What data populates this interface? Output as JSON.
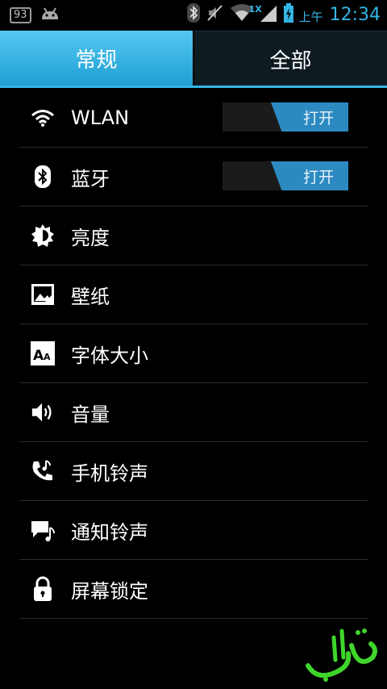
{
  "status_bar": {
    "notification_badge": "93",
    "ampm": "上午",
    "time": "12:34",
    "network_type": "1X"
  },
  "tabs": [
    {
      "label": "常规",
      "active": true
    },
    {
      "label": "全部",
      "active": false
    }
  ],
  "settings": [
    {
      "label": "WLAN",
      "icon": "wifi-icon",
      "toggle": "打开"
    },
    {
      "label": "蓝牙",
      "icon": "bluetooth-icon",
      "toggle": "打开"
    },
    {
      "label": "亮度",
      "icon": "brightness-icon"
    },
    {
      "label": "壁纸",
      "icon": "wallpaper-icon"
    },
    {
      "label": "字体大小",
      "icon": "font-size-icon"
    },
    {
      "label": "音量",
      "icon": "volume-icon"
    },
    {
      "label": "手机铃声",
      "icon": "phone-ringtone-icon"
    },
    {
      "label": "通知铃声",
      "icon": "notification-ringtone-icon"
    },
    {
      "label": "屏幕锁定",
      "icon": "lock-icon"
    }
  ],
  "colors": {
    "accent": "#33b5e5",
    "toggle_on": "#2c8ac1",
    "background": "#000000"
  }
}
